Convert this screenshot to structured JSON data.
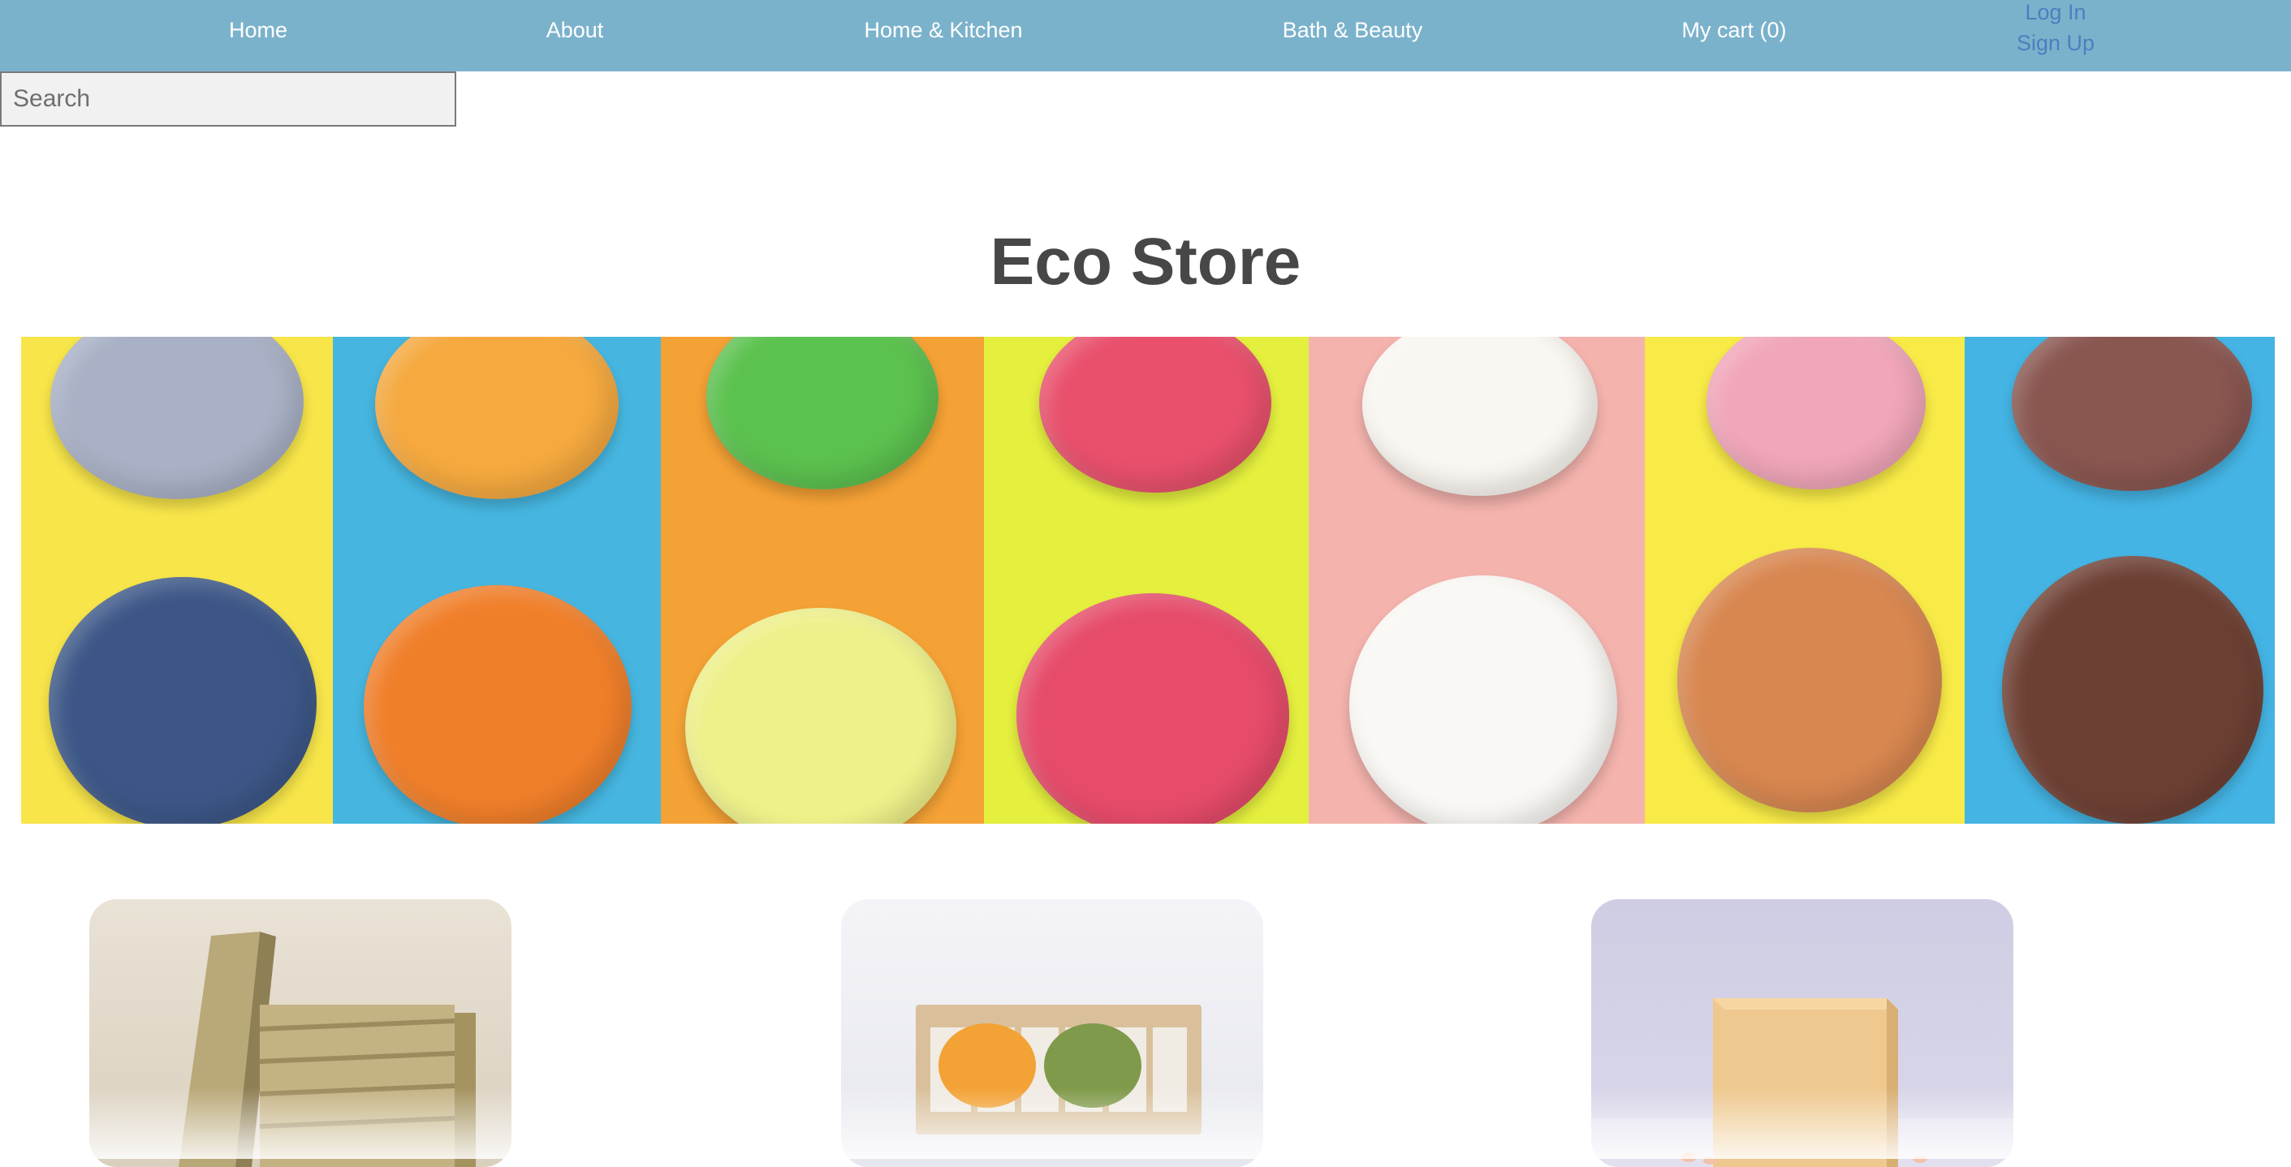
{
  "nav": {
    "items": [
      "Home",
      "About",
      "Home & Kitchen",
      "Bath & Beauty",
      "My cart (0)"
    ],
    "login": "Log In",
    "signup": "Sign Up",
    "background": "#7bb2cb"
  },
  "search": {
    "placeholder": "Search",
    "value": ""
  },
  "hero": {
    "title": "Eco Store"
  },
  "banner": {
    "stripes": [
      {
        "bg": "#f7e54a",
        "top": "#a9b1c6",
        "bottom": "#3c5787"
      },
      {
        "bg": "#46b6e0",
        "top": "#f5a93f",
        "bottom": "#f07f2a"
      },
      {
        "bg": "#f4a135",
        "top": "#5cc24f",
        "bottom": "#eef08a"
      },
      {
        "bg": "#e5ef3e",
        "top": "#e9506c",
        "bottom": "#e64b6a"
      },
      {
        "bg": "#f4b3ad",
        "top": "#faf7f2",
        "bottom": "#faf8f4"
      },
      {
        "bg": "#f8ea47",
        "top": "#f1a6b9",
        "bottom": "#d88750"
      },
      {
        "bg": "#44b4e4",
        "top": "#8a5650",
        "bottom": "#6e4034"
      }
    ]
  },
  "products": [
    {
      "name": "bamboo-soap-dish"
    },
    {
      "name": "shampoo-bars-on-wooden-tray"
    },
    {
      "name": "natural-soap-bar"
    }
  ]
}
